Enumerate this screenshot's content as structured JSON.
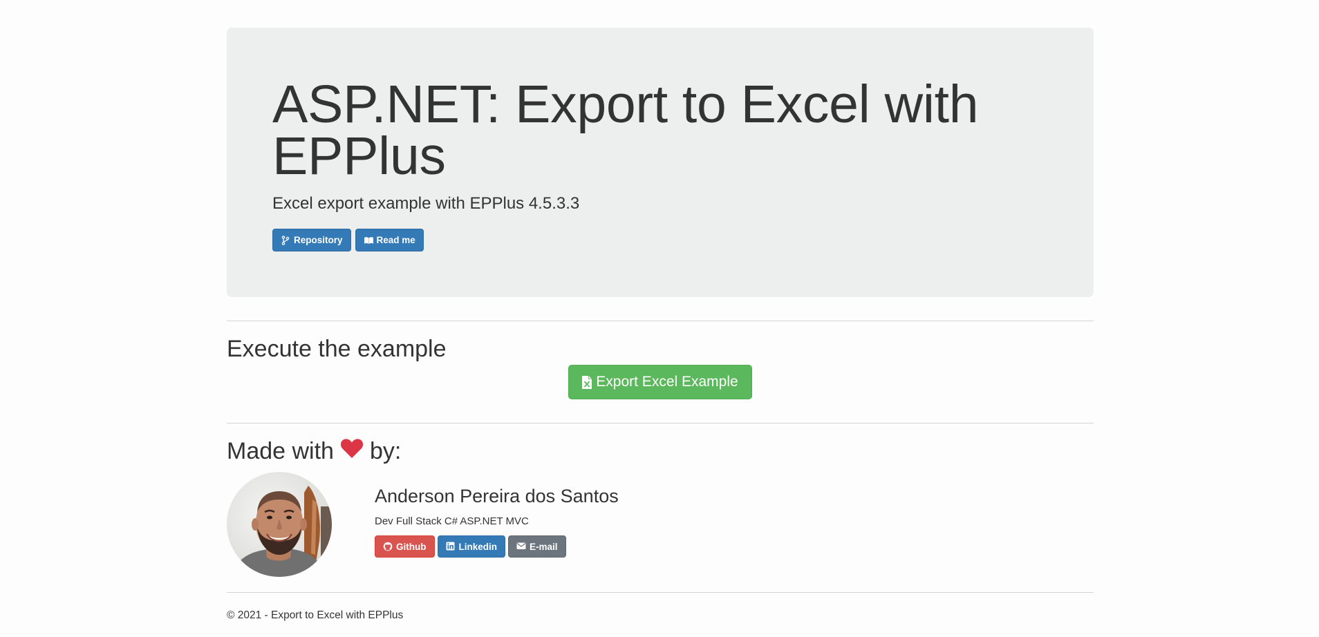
{
  "header": {
    "title": "ASP.NET: Export to Excel with EPPlus",
    "subtitle": "Excel export example with EPPlus 4.5.3.3",
    "buttons": [
      {
        "label": "Repository",
        "icon": "code-branch-icon"
      },
      {
        "label": "Read me",
        "icon": "book-open-icon"
      }
    ]
  },
  "execute": {
    "title": "Execute the example",
    "export_button": {
      "label": "Export Excel Example",
      "icon": "file-excel-icon"
    }
  },
  "credits": {
    "title_prefix": "Made with",
    "title_suffix": "by:",
    "heart_icon": "heart-icon",
    "author": {
      "name": "Anderson Pereira dos Santos",
      "role": "Dev Full Stack C# ASP.NET MVC",
      "links": [
        {
          "label": "Github",
          "icon": "github-icon"
        },
        {
          "label": "Linkedin",
          "icon": "linkedin-icon"
        },
        {
          "label": "E-mail",
          "icon": "envelope-icon"
        }
      ]
    }
  },
  "footer": {
    "text": "© 2021 - Export to Excel with EPPlus"
  },
  "colors": {
    "primary": "#337ab7",
    "success": "#5cb85c",
    "danger": "#d9534f",
    "secondary": "#6c757d",
    "heart": "#dc3545",
    "jumbotron_bg": "#edeeee"
  }
}
